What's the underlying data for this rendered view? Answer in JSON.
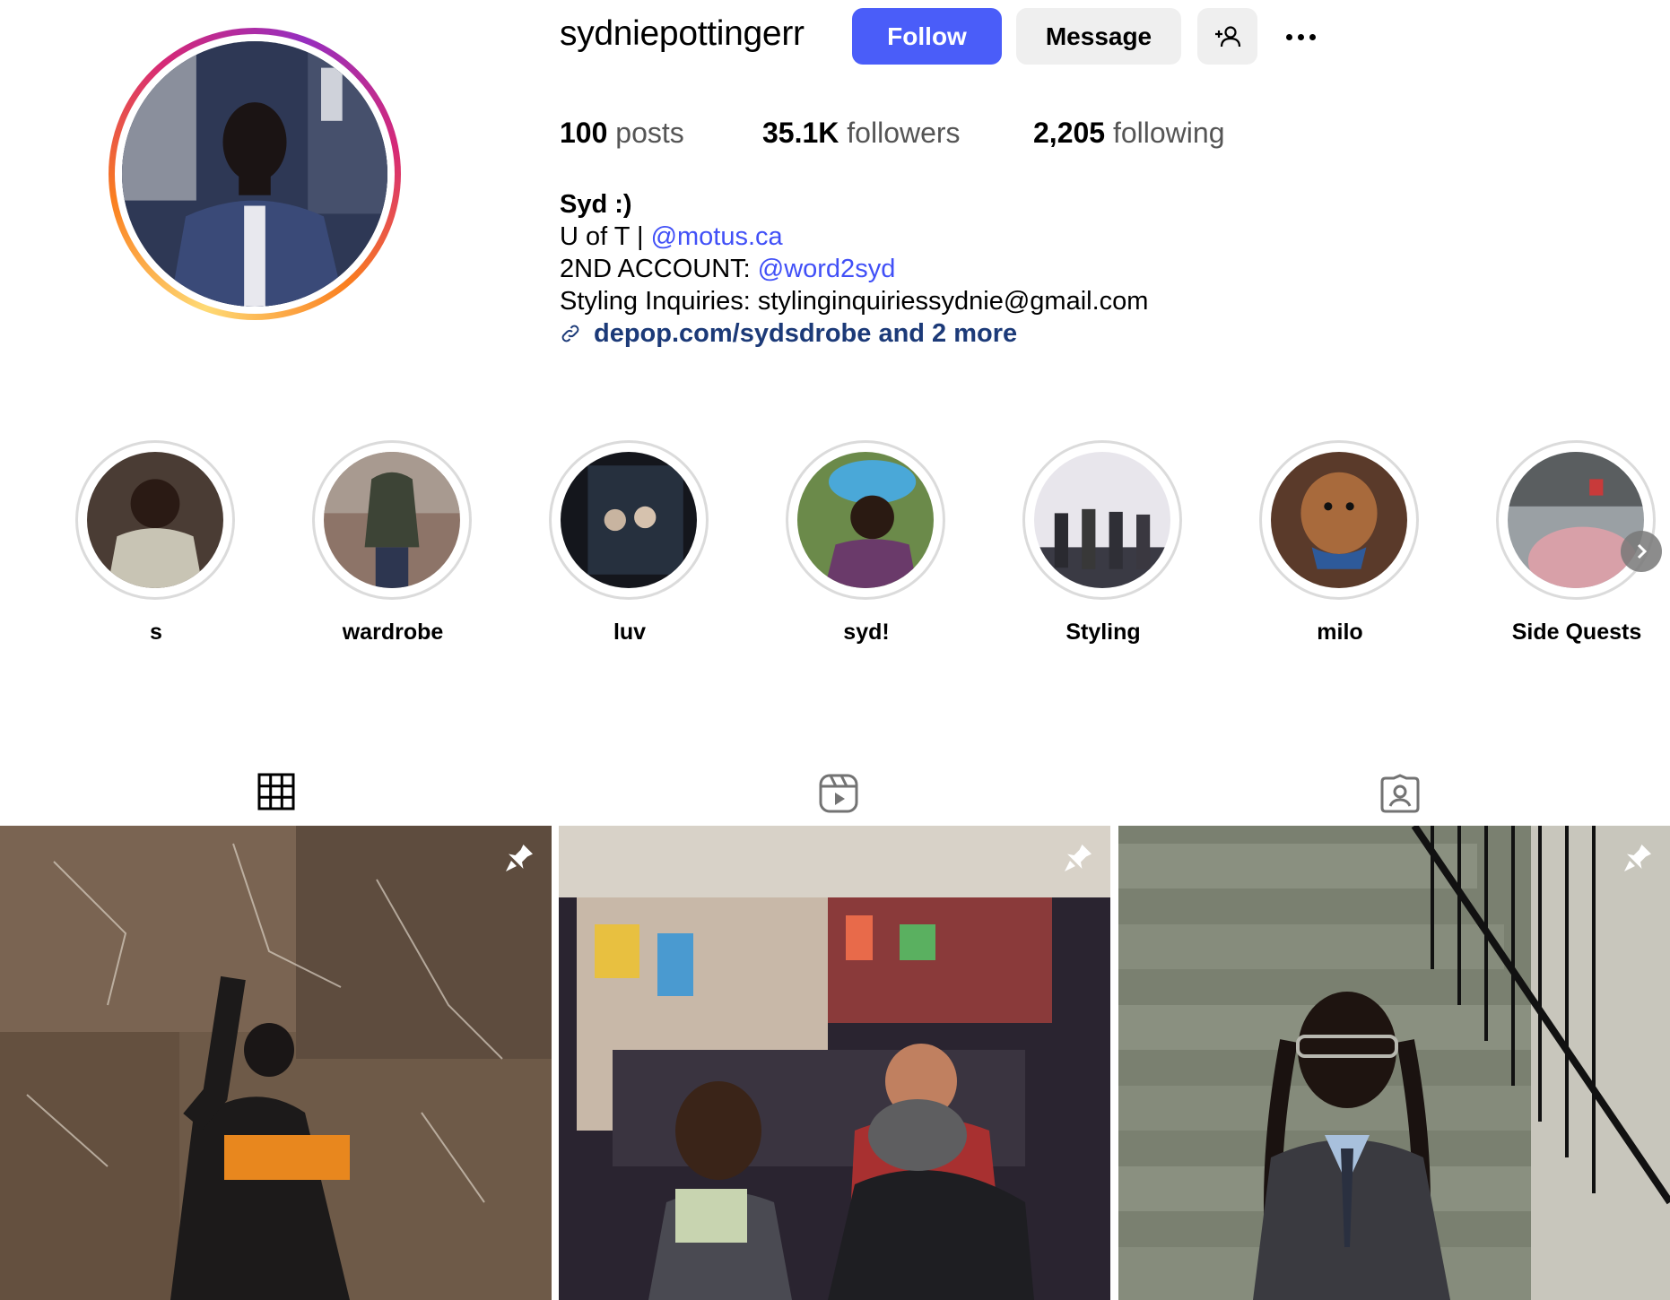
{
  "profile": {
    "username": "sydniepottingerr",
    "follow_label": "Follow",
    "message_label": "Message",
    "stats": {
      "posts_count": "100",
      "posts_label": "posts",
      "followers_count": "35.1K",
      "followers_label": "followers",
      "following_count": "2,205",
      "following_label": "following"
    },
    "bio": {
      "name": "Syd :)",
      "line1_text": "U of T | ",
      "line1_mention": "@motus.ca",
      "line2_text": "2ND ACCOUNT: ",
      "line2_mention": "@word2syd",
      "line3": "Styling Inquiries: stylinginquiriessydnie@gmail.com",
      "link": "depop.com/sydsdrobe and 2 more"
    }
  },
  "highlights": [
    {
      "label": "s"
    },
    {
      "label": "wardrobe"
    },
    {
      "label": "luv"
    },
    {
      "label": "syd!"
    },
    {
      "label": "Styling"
    },
    {
      "label": "milo"
    },
    {
      "label": "Side Quests"
    }
  ],
  "colors": {
    "follow_button": "#4a5df9",
    "mention": "#4150f7",
    "link": "#1c3a78",
    "secondary_button": "#efefef"
  }
}
